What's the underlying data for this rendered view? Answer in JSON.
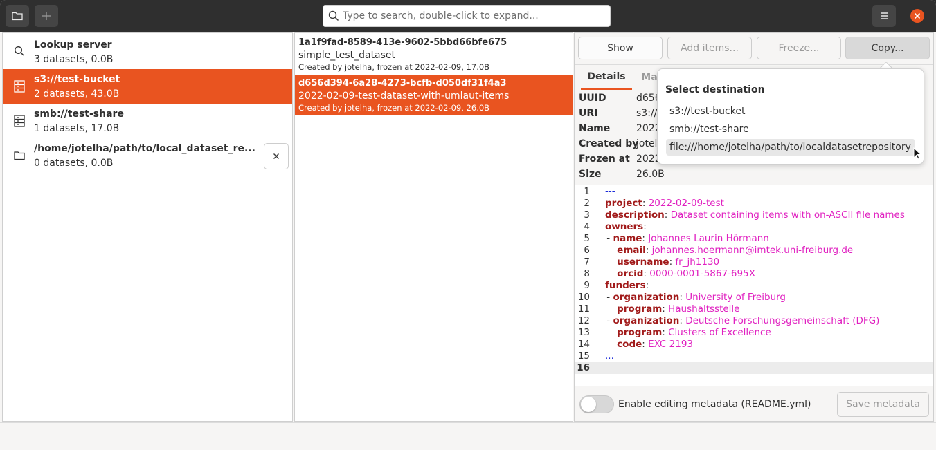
{
  "header": {
    "open_button_icon": "folder-icon",
    "add_button_icon": "plus-icon",
    "search_placeholder": "Type to search, double-click to expand...",
    "menu_icon": "hamburger-menu-icon",
    "close_icon": "close-icon"
  },
  "repositories": [
    {
      "name": "Lookup server",
      "summary": "3 datasets, 0.0B",
      "icon": "search-icon",
      "selected": false
    },
    {
      "name": "s3://test-bucket",
      "summary": "2 datasets, 43.0B",
      "icon": "server-icon",
      "selected": true
    },
    {
      "name": "smb://test-share",
      "summary": "1 datasets, 17.0B",
      "icon": "server-icon",
      "selected": false
    },
    {
      "name": "/home/jotelha/path/to/local_dataset_re...",
      "summary": "0 datasets, 0.0B",
      "icon": "folder-icon",
      "selected": false
    }
  ],
  "datasets": [
    {
      "uuid": "1a1f9fad-8589-413e-9602-5bbd66bfe675",
      "name": "simple_test_dataset",
      "meta": "Created by jotelha, frozen at 2022-02-09, 17.0B",
      "selected": false
    },
    {
      "uuid": "d656d394-6a28-4273-bcfb-d050df31f4a3",
      "name": "2022-02-09-test-dataset-with-umlaut-items",
      "meta": "Created by jotelha, frozen at 2022-02-09, 26.0B",
      "selected": true
    }
  ],
  "actions": {
    "show": "Show",
    "add_items": "Add items...",
    "freeze": "Freeze...",
    "copy": "Copy..."
  },
  "tabs": {
    "details": "Details",
    "manifest_partial": "Ma"
  },
  "details": [
    {
      "key": "UUID",
      "value": "d656"
    },
    {
      "key": "URI",
      "value": "s3://"
    },
    {
      "key": "Name",
      "value": "2022"
    },
    {
      "key": "Created by",
      "value": "jotel"
    },
    {
      "key": "Frozen at",
      "value": "2022"
    },
    {
      "key": "Size",
      "value": "26.0B"
    }
  ],
  "editor": {
    "current_line": 16,
    "lines": [
      {
        "n": "1",
        "indent": "",
        "dash": false,
        "key": "",
        "value": "",
        "raw": "---",
        "raw_class": "b"
      },
      {
        "n": "2",
        "indent": "",
        "dash": false,
        "key": "project",
        "value": "2022-02-09-test"
      },
      {
        "n": "3",
        "indent": "",
        "dash": false,
        "key": "description",
        "value": "Dataset containing items with on-ASCII file names"
      },
      {
        "n": "4",
        "indent": "",
        "dash": false,
        "key": "owners",
        "value": ""
      },
      {
        "n": "5",
        "indent": "  ",
        "dash": true,
        "key": "name",
        "value": "Johannes Laurin Hörmann"
      },
      {
        "n": "6",
        "indent": "    ",
        "dash": false,
        "key": "email",
        "value": "johannes.hoermann@imtek.uni-freiburg.de"
      },
      {
        "n": "7",
        "indent": "    ",
        "dash": false,
        "key": "username",
        "value": "fr_jh1130"
      },
      {
        "n": "8",
        "indent": "    ",
        "dash": false,
        "key": "orcid",
        "value": "0000-0001-5867-695X"
      },
      {
        "n": "9",
        "indent": "",
        "dash": false,
        "key": "funders",
        "value": ""
      },
      {
        "n": "10",
        "indent": "  ",
        "dash": true,
        "key": "organization",
        "value": "University of Freiburg"
      },
      {
        "n": "11",
        "indent": "    ",
        "dash": false,
        "key": "program",
        "value": "Haushaltsstelle"
      },
      {
        "n": "12",
        "indent": "  ",
        "dash": true,
        "key": "organization",
        "value": "Deutsche Forschungsgemeinschaft (DFG)"
      },
      {
        "n": "13",
        "indent": "    ",
        "dash": false,
        "key": "program",
        "value": "Clusters of Excellence"
      },
      {
        "n": "14",
        "indent": "    ",
        "dash": false,
        "key": "code",
        "value": "EXC 2193"
      },
      {
        "n": "15",
        "indent": "",
        "dash": false,
        "key": "",
        "value": "",
        "raw": "...",
        "raw_class": "b"
      },
      {
        "n": "16",
        "indent": "",
        "dash": false,
        "key": "",
        "value": "",
        "raw": "",
        "raw_class": "p"
      }
    ]
  },
  "footer": {
    "toggle_label": "Enable editing metadata (README.yml)",
    "toggle_on": false,
    "save_label": "Save metadata"
  },
  "popover": {
    "title": "Select destination",
    "items": [
      {
        "label": "s3://test-bucket",
        "hover": false
      },
      {
        "label": "smb://test-share",
        "hover": false
      },
      {
        "label": "file:///home/jotelha/path/to/localdatasetrepository",
        "hover": true
      }
    ]
  },
  "colors": {
    "accent": "#e95420",
    "yaml_key": "#a11a1a",
    "yaml_value": "#e020c0",
    "yaml_marker": "#1a2ad8"
  }
}
